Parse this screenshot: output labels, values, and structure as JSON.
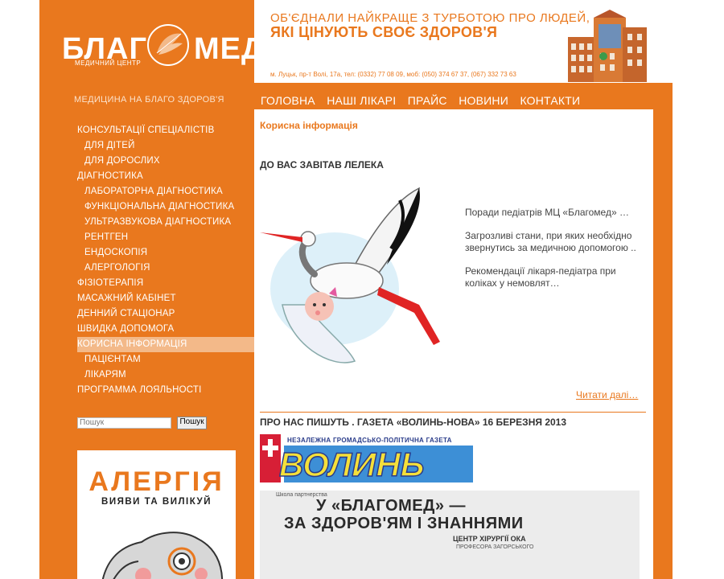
{
  "brand": {
    "logo_left": "БЛАГ",
    "logo_right": "МЕД",
    "logo_sub": "МЕДИЧНИЙ ЦЕНТР",
    "slogan": "МЕДИЦИНА НА БЛАГО ЗДОРОВ'Я",
    "color_accent": "#e9781e"
  },
  "banner": {
    "line1": "ОБ'ЄДНАЛИ НАЙКРАЩЕ З ТУРБОТОЮ ПРО ЛЮДЕЙ,",
    "line2": "ЯКІ ЦІНУЮТЬ СВОЄ ЗДОРОВ'Я",
    "address": "м. Луцьк, пр-т Волі, 17а, тел: (0332) 77 08 09, моб: (050) 374 67 37, (067) 332 73 63"
  },
  "topnav": [
    "ГОЛОВНА",
    "НАШІ ЛІКАРІ",
    "ПРАЙС",
    "НОВИНИ",
    "КОНТАКТИ"
  ],
  "sidebar": {
    "items": [
      {
        "label": "КОНСУЛЬТАЦІЇ СПЕЦІАЛІСТІВ",
        "sub": false,
        "active": false
      },
      {
        "label": "ДЛЯ ДІТЕЙ",
        "sub": true,
        "active": false
      },
      {
        "label": "ДЛЯ ДОРОСЛИХ",
        "sub": true,
        "active": false
      },
      {
        "label": "ДІАГНОСТИКА",
        "sub": false,
        "active": false
      },
      {
        "label": "ЛАБОРАТОРНА ДІАГНОСТИКА",
        "sub": true,
        "active": false
      },
      {
        "label": "ФУНКЦІОНАЛЬНА ДІАГНОСТИКА",
        "sub": true,
        "active": false
      },
      {
        "label": "УЛЬТРАЗВУКОВА ДІАГНОСТИКА",
        "sub": true,
        "active": false
      },
      {
        "label": "РЕНТГЕН",
        "sub": true,
        "active": false
      },
      {
        "label": "ЕНДОСКОПІЯ",
        "sub": true,
        "active": false
      },
      {
        "label": "АЛЕРГОЛОГІЯ",
        "sub": true,
        "active": false
      },
      {
        "label": "ФІЗІОТЕРАПІЯ",
        "sub": false,
        "active": false
      },
      {
        "label": "МАСАЖНИЙ КАБІНЕТ",
        "sub": false,
        "active": false
      },
      {
        "label": "ДЕННИЙ СТАЦІОНАР",
        "sub": false,
        "active": false
      },
      {
        "label": "ШВИДКА ДОПОМОГА",
        "sub": false,
        "active": false
      },
      {
        "label": "КОРИСНА ІНФОРМАЦІЯ",
        "sub": false,
        "active": true
      },
      {
        "label": "ПАЦІЄНТАМ",
        "sub": true,
        "active": false
      },
      {
        "label": "ЛІКАРЯМ",
        "sub": true,
        "active": false
      },
      {
        "label": "ПРОГРАММА ЛОЯЛЬНОСТІ",
        "sub": false,
        "active": false
      }
    ]
  },
  "search": {
    "placeholder": "Пошук",
    "button": "Пошук"
  },
  "ad": {
    "title": "АЛЕРГІЯ",
    "subtitle": "ВИЯВИ ТА ВИЛІКУЙ"
  },
  "content": {
    "section_label": "Корисна інформація",
    "article1_title": "ДО ВАС ЗАВІТАВ ЛЕЛЕКА",
    "links": [
      "Поради педіатрів МЦ «Благомед» …",
      "Загрозливі стани, при яких необхідно звернутись за медичною допомогою ..",
      "Рекомендації лікаря-педіатра при коліках у немовлят…"
    ],
    "readmore": "Читати далі…",
    "article2_title": "ПРО НАС ПИШУТЬ . ГАЗЕТА «ВОЛИНЬ-НОВА» 16 БЕРЕЗНЯ 2013"
  },
  "newspaper": {
    "slogan": "НЕЗАЛЕЖНА ГРОМАДСЬКО-ПОЛІТИЧНА ГАЗЕТА",
    "name": "ВОЛИНЬ",
    "rubric": "Школа партнерства",
    "headline1": "У «БЛАГОМЕД» —",
    "headline2": "ЗА ЗДОРОВ'ЯМ І ЗНАННЯМИ",
    "badge": "ЦЕНТР ХІРУРГІЇ ОКА",
    "badge_sub": "ПРОФЕСОРА ЗАГОРСЬКОГО"
  }
}
